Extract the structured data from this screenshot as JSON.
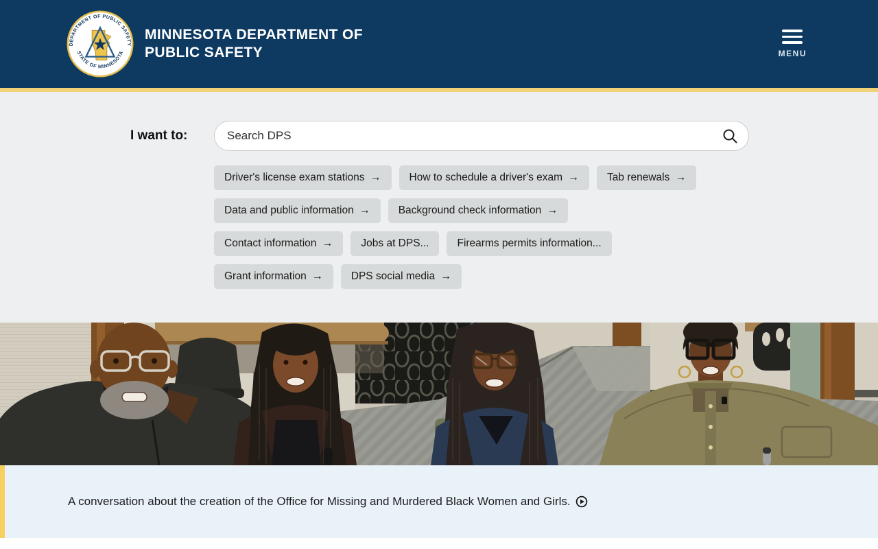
{
  "header": {
    "title_line1": "MINNESOTA DEPARTMENT OF",
    "title_line2": "PUBLIC SAFETY",
    "menu_label": "MENU",
    "seal": {
      "top_text": "DEPARTMENT OF PUBLIC SAFETY",
      "bottom_text": "STATE OF MINNESOTA"
    }
  },
  "search": {
    "label": "I want to:",
    "placeholder": "Search DPS"
  },
  "quick_links_rows": [
    [
      {
        "id": "drivers-license-exam-stations",
        "label": "Driver's license exam stations",
        "glyph": "→"
      },
      {
        "id": "how-to-schedule-a-drivers-exam",
        "label": "How to schedule a driver's exam",
        "glyph": "→"
      },
      {
        "id": "tab-renewals",
        "label": "Tab renewals",
        "glyph": "→"
      }
    ],
    [
      {
        "id": "data-and-public-information",
        "label": "Data and public information",
        "glyph": "→"
      },
      {
        "id": "background-check-information",
        "label": "Background check information",
        "glyph": "→"
      }
    ],
    [
      {
        "id": "contact-information",
        "label": "Contact information",
        "glyph": "→"
      },
      {
        "id": "jobs-at-dps",
        "label": "Jobs at DPS...",
        "glyph": ""
      },
      {
        "id": "firearms-permits-information",
        "label": "Firearms permits information...",
        "glyph": ""
      }
    ],
    [
      {
        "id": "grant-information",
        "label": "Grant information",
        "glyph": "→"
      },
      {
        "id": "dps-social-media",
        "label": "DPS social media",
        "glyph": "→"
      }
    ]
  ],
  "hero_caption": "A conversation about the creation of the Office for Missing and Murdered Black Women and Girls.",
  "icons": {
    "menu": "hamburger-icon",
    "search": "magnifier-icon",
    "play": "play-circle-icon",
    "seal": "mn-dps-seal"
  },
  "colors": {
    "header_navy": "#0e3a62",
    "gold_bar": "#f2d279",
    "section_gray": "#edeff0",
    "button_gray": "#d7dada",
    "caption_blue": "#e9f1f9",
    "caption_border_gold": "#f6d061"
  }
}
